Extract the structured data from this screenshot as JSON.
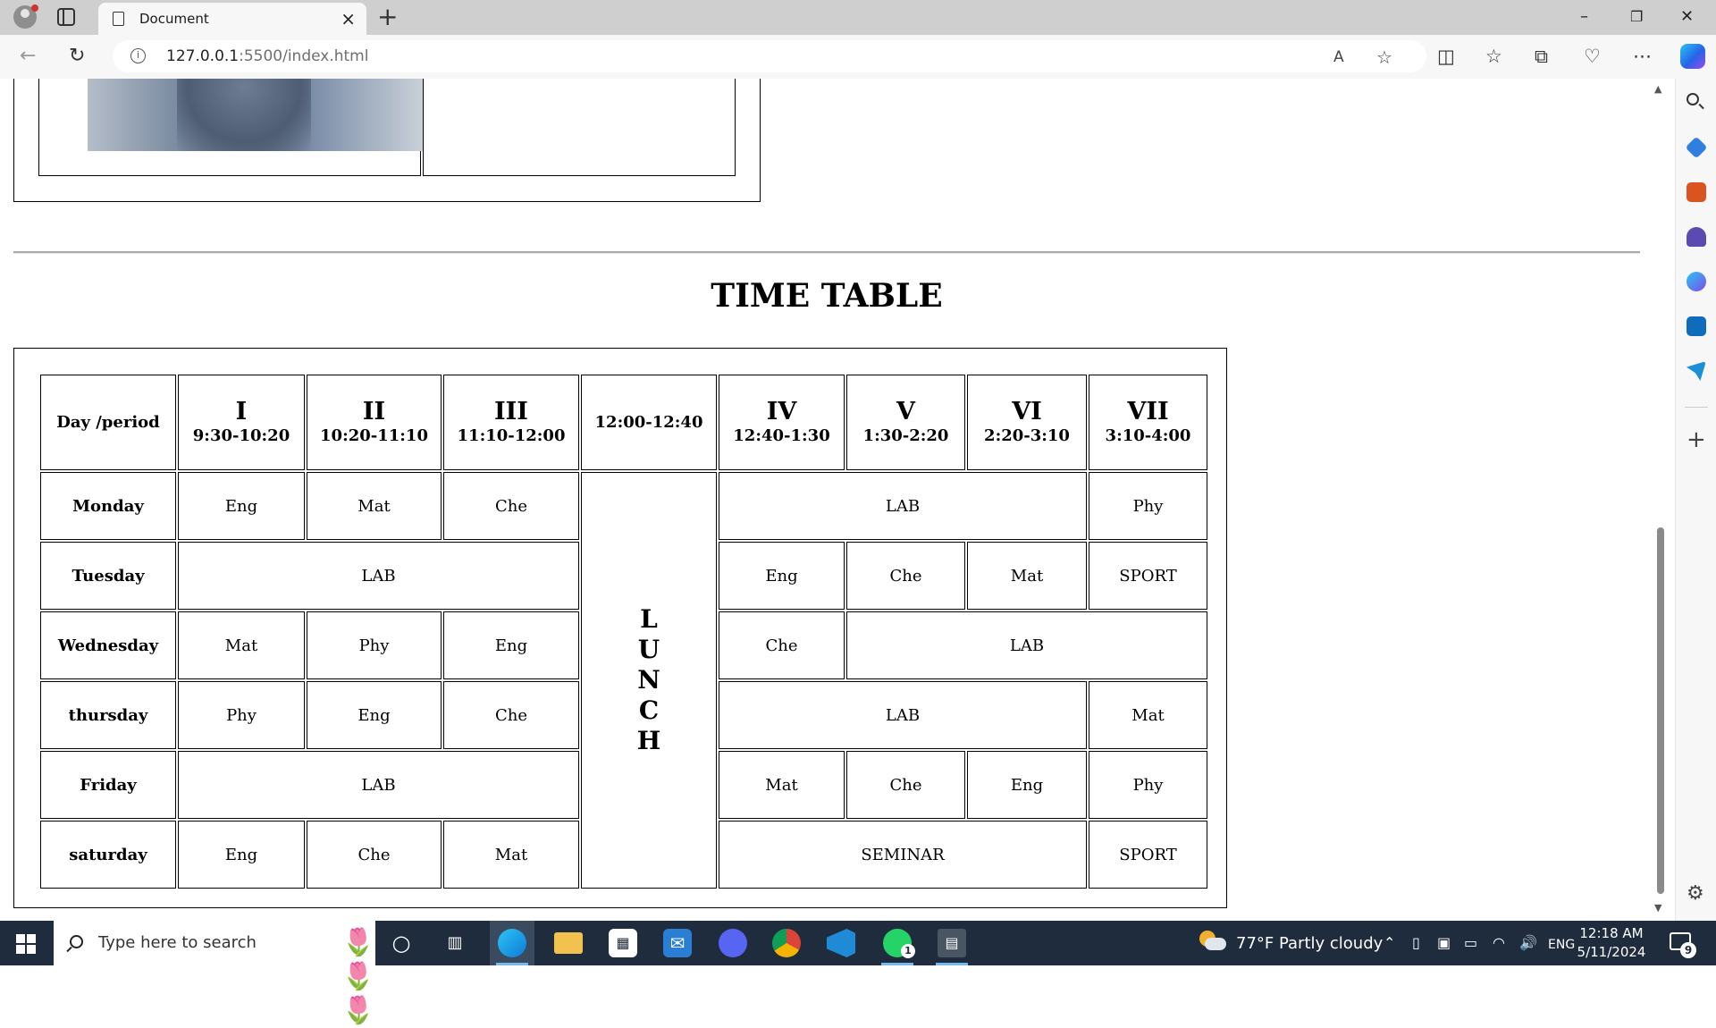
{
  "browser": {
    "tab_title": "Document",
    "tab_close": "×",
    "new_tab": "+",
    "url_host": "127.0.0.1",
    "url_rest": ":5500/index.html",
    "window_controls": {
      "minimize": "–",
      "restore": "❐",
      "close": "✕"
    }
  },
  "page": {
    "heading": "TIME TABLE",
    "timetable": {
      "corner": "Day /period",
      "periods": [
        {
          "roman": "I",
          "time": "9:30-10:20"
        },
        {
          "roman": "II",
          "time": "10:20-11:10"
        },
        {
          "roman": "III",
          "time": "11:10-12:00"
        },
        {
          "roman": "",
          "time": "12:00-12:40"
        },
        {
          "roman": "IV",
          "time": "12:40-1:30"
        },
        {
          "roman": "V",
          "time": "1:30-2:20"
        },
        {
          "roman": "VI",
          "time": "2:20-3:10"
        },
        {
          "roman": "VII",
          "time": "3:10-4:00"
        }
      ],
      "lunch_letters": [
        "L",
        "U",
        "N",
        "C",
        "H"
      ],
      "days": [
        "Monday",
        "Tuesday",
        "Wednesday",
        "thursday",
        "Friday",
        "saturday"
      ],
      "monday": {
        "p1": "Eng",
        "p2": "Mat",
        "p3": "Che",
        "p4_6": "LAB",
        "p7": "Phy"
      },
      "tuesday": {
        "p1_3": "LAB",
        "p4": "Eng",
        "p5": "Che",
        "p6": "Mat",
        "p7": "SPORT"
      },
      "wednesday": {
        "p1": "Mat",
        "p2": "Phy",
        "p3": "Eng",
        "p4": "Che",
        "p5_7": "LAB"
      },
      "thursday": {
        "p1": "Phy",
        "p2": "Eng",
        "p3": "Che",
        "p4_6": "LAB",
        "p7": "Mat"
      },
      "friday": {
        "p1_3": "LAB",
        "p4": "Mat",
        "p5": "Che",
        "p6": "Eng",
        "p7": "Phy"
      },
      "saturday": {
        "p1": "Eng",
        "p2": "Che",
        "p3": "Mat",
        "p4_6": "SEMINAR",
        "p7": "SPORT"
      }
    }
  },
  "taskbar": {
    "search_placeholder": "Type here to search",
    "weather": "77°F  Partly cloudy",
    "language": "ENG",
    "time": "12:18 AM",
    "date": "5/11/2024",
    "whatsapp_badge": "1",
    "notification_count": "9"
  },
  "colors": {
    "tabstrip": "#cfcfcf",
    "toolbar": "#f7f7f7",
    "taskbar": "#1f2c3d",
    "edge_blue": "#0f7bd6"
  }
}
